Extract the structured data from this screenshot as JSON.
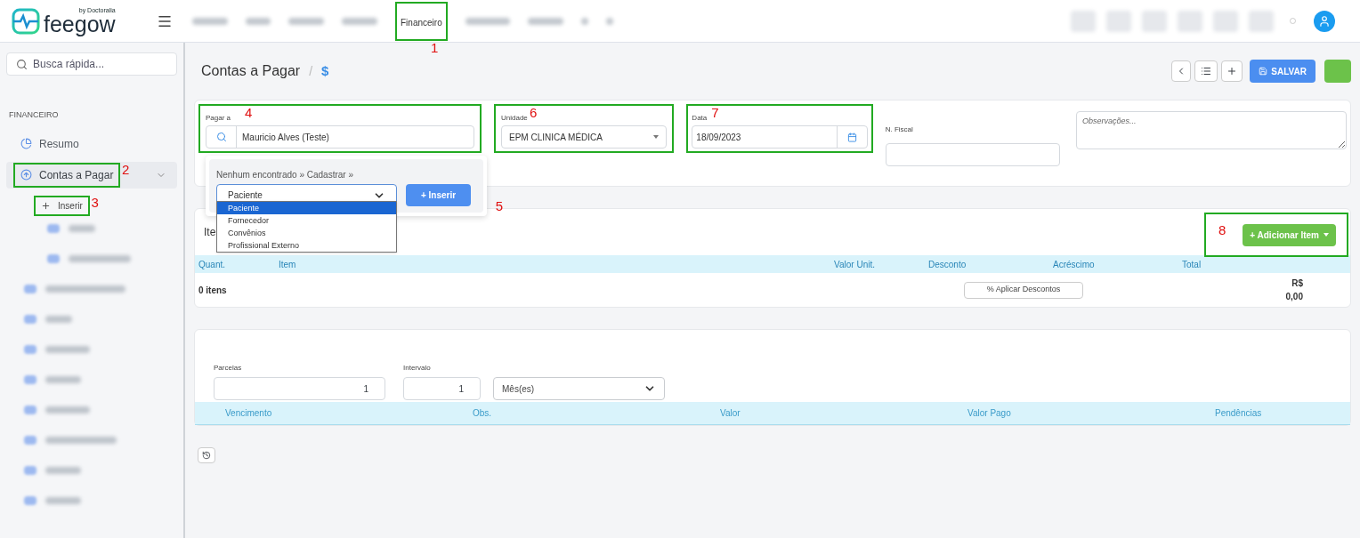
{
  "logo": {
    "name": "feegow",
    "byline": "by Doctoralia"
  },
  "top_nav": [
    {
      "label": "Financeiro",
      "selected": true,
      "callout": "1"
    }
  ],
  "search": {
    "placeholder": "Busca rápida..."
  },
  "sidebar": {
    "section": "FINANCEIRO",
    "items": [
      {
        "label": "Resumo",
        "selected": false,
        "kind": "chart"
      },
      {
        "label": "Contas a Pagar",
        "selected": true,
        "expanded": true,
        "kind": "upload",
        "callout": "2",
        "children": [
          {
            "label": "Inserir",
            "callout": "3"
          }
        ]
      }
    ]
  },
  "page": {
    "title": "Contas a Pagar",
    "separator": "/",
    "crumb": "$",
    "save": "SALVAR"
  },
  "form": {
    "pagar_a": {
      "label": "Pagar a",
      "value": "Mauricio Alves (Teste)",
      "callout": "4"
    },
    "unidade": {
      "label": "Unidade",
      "value": "EPM CLINICA MÉDICA",
      "callout": "6"
    },
    "data": {
      "label": "Data",
      "value": "18/09/2023",
      "callout": "7"
    },
    "n_fiscal": {
      "label": "N. Fiscal"
    },
    "observacoes": {
      "placeholder": "Observações..."
    }
  },
  "popup": {
    "message": "Nenhum encontrado » Cadastrar »",
    "select": "Paciente",
    "button": "+ Inserir",
    "callout": "5",
    "options": [
      {
        "label": "Paciente",
        "selected": true
      },
      {
        "label": "Fornecedor",
        "selected": false
      },
      {
        "label": "Convênios",
        "selected": false
      },
      {
        "label": "Profissional Externo",
        "selected": false
      }
    ]
  },
  "items": {
    "title": "Ite",
    "add_button": "+ Adicionar Item",
    "callout": "8",
    "columns": [
      "Quant.",
      "Item",
      "Valor Unit.",
      "Desconto",
      "Acréscimo",
      "Total"
    ],
    "count": "0 itens",
    "discount_button": "% Aplicar Descontos",
    "total": "R$ 0,00"
  },
  "installments": {
    "parcelas_label": "Parcelas",
    "parcelas": "1",
    "intervalo_label": "Intervalo",
    "intervalo": "1",
    "unit": "Mês(es)",
    "columns": [
      "Vencimento",
      "Obs.",
      "Valor",
      "Valor Pago",
      "Pendências"
    ]
  }
}
